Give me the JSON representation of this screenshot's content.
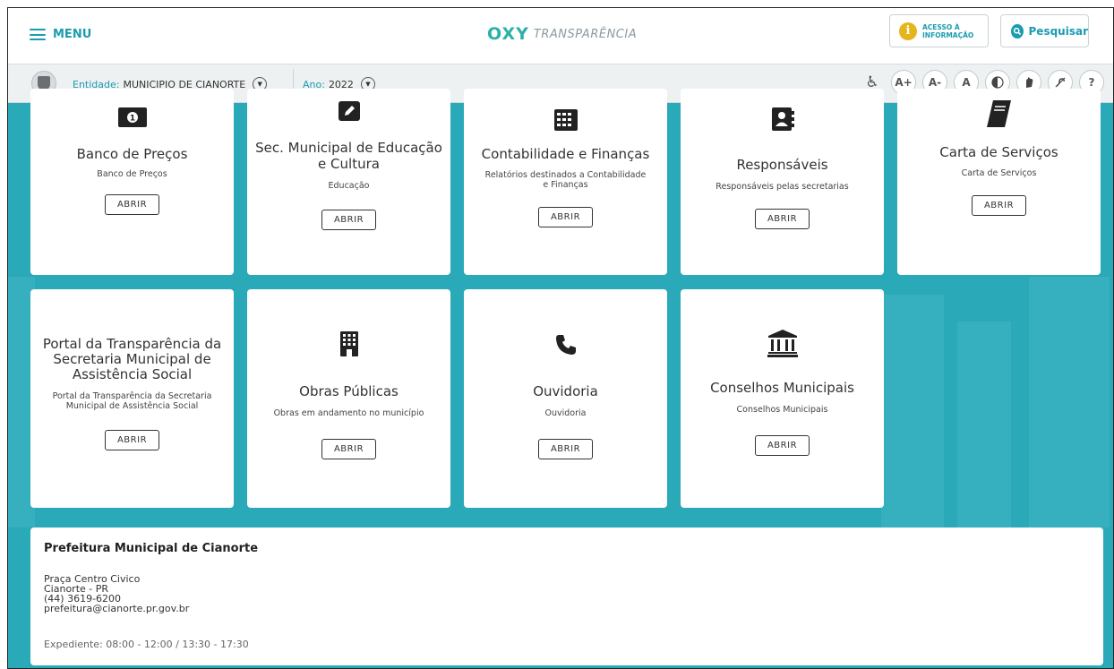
{
  "header": {
    "menu_label": "MENU",
    "logo_oxy": "OXY",
    "logo_text": "TRANSPARÊNCIA",
    "acesso_line1": "ACESSO À",
    "acesso_line2": "INFORMAÇÃO",
    "search_label": "Pesquisar"
  },
  "filters": {
    "entidade_label": "Entidade:",
    "entidade_value": "MUNICIPIO DE CIANORTE",
    "ano_label": "Ano:",
    "ano_value": "2022"
  },
  "accessibility": {
    "increase": "A+",
    "decrease": "A-",
    "reset": "A",
    "help": "?"
  },
  "cards": [
    {
      "title": "Banco de Preços",
      "subtitle": "Banco de Preços",
      "button": "ABRIR",
      "icon": "money-icon"
    },
    {
      "title": "Sec. Municipal de Educação e Cultura",
      "subtitle": "Educação",
      "button": "ABRIR",
      "icon": "edit-icon"
    },
    {
      "title": "Contabilidade e Finanças",
      "subtitle": "Relatórios destinados a Contabilidade e Finanças",
      "button": "ABRIR",
      "icon": "calculator-icon"
    },
    {
      "title": "Responsáveis",
      "subtitle": "Responsáveis pelas secretarias",
      "button": "ABRIR",
      "icon": "address-book-icon"
    },
    {
      "title": "Carta de Serviços",
      "subtitle": "Carta de Serviços",
      "button": "ABRIR",
      "icon": "book-icon"
    },
    {
      "title": "Portal da Transparência da Secretaria Municipal de Assistência Social",
      "subtitle": "Portal da Transparência da Secretaria Municipal de Assistência Social",
      "button": "ABRIR",
      "icon": "none"
    },
    {
      "title": "Obras Públicas",
      "subtitle": "Obras em andamento no município",
      "button": "ABRIR",
      "icon": "building-icon"
    },
    {
      "title": "Ouvidoria",
      "subtitle": "Ouvidoria",
      "button": "ABRIR",
      "icon": "phone-icon"
    },
    {
      "title": "Conselhos Municipais",
      "subtitle": "Conselhos Municipais",
      "button": "ABRIR",
      "icon": "institution-icon"
    }
  ],
  "footer": {
    "title": "Prefeitura Municipal de Cianorte",
    "address1": "Praça Centro Civico",
    "address2": "Cianorte - PR",
    "phone": "(44) 3619-6200",
    "email": "prefeitura@cianorte.pr.gov.br",
    "hours": "Expediente: 08:00 - 12:00 / 13:30 - 17:30"
  },
  "colors": {
    "accent": "#1a9cb0",
    "background": "#2aa9b9",
    "info": "#e6b51c"
  }
}
